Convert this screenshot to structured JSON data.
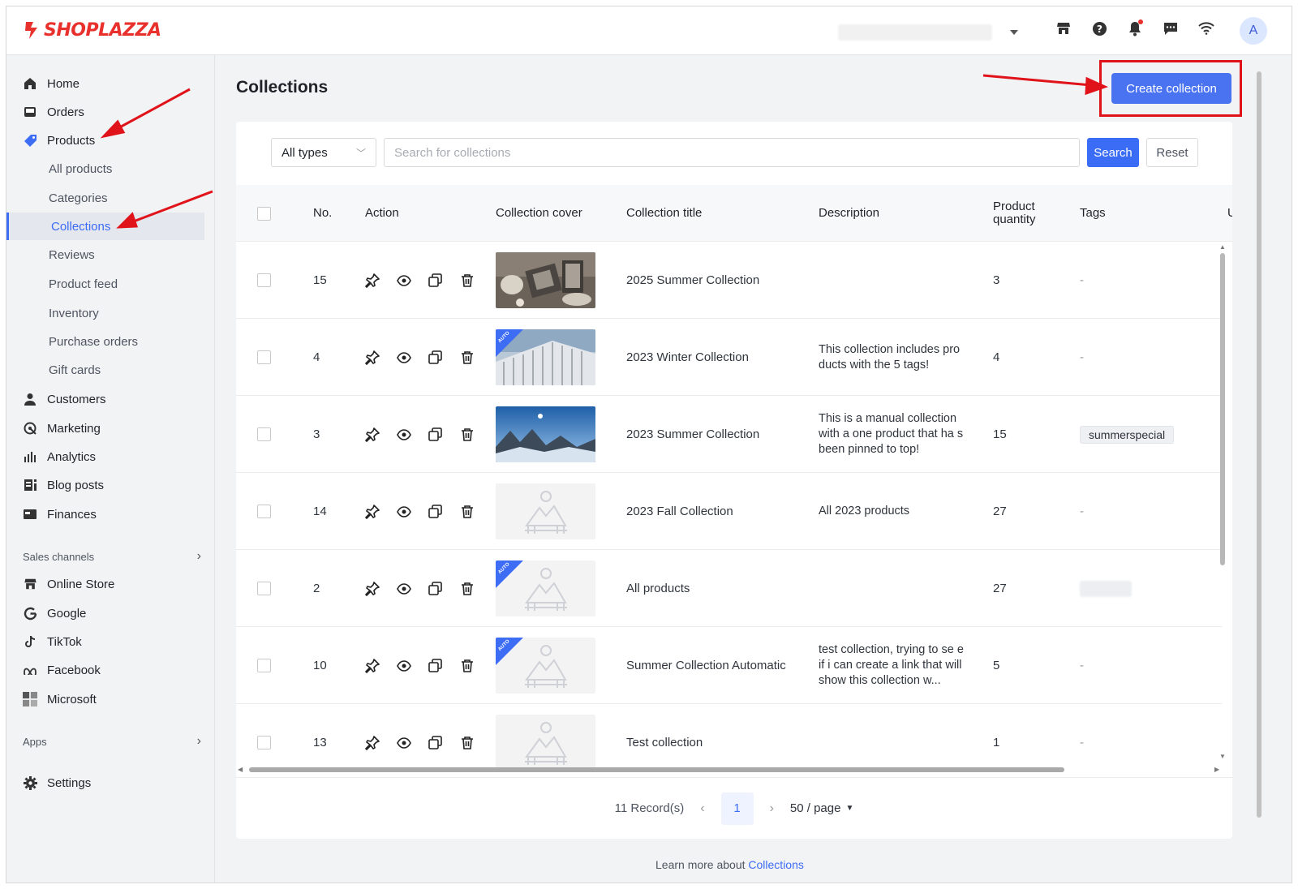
{
  "brand": {
    "name": "SHOPLAZZA",
    "color": "#e8302c"
  },
  "topbar": {
    "icons": [
      "store-icon",
      "help-icon",
      "bell-icon",
      "chat-icon",
      "wifi-icon"
    ],
    "avatar_letter": "A"
  },
  "sidebar": {
    "main_items": [
      {
        "label": "Home",
        "icon": "home-icon"
      },
      {
        "label": "Orders",
        "icon": "orders-icon"
      },
      {
        "label": "Products",
        "icon": "tag-icon"
      }
    ],
    "product_sub_items": [
      "All products",
      "Categories",
      "Collections",
      "Reviews",
      "Product feed",
      "Inventory",
      "Purchase orders",
      "Gift cards"
    ],
    "active_sub_item": "Collections",
    "more_items": [
      {
        "label": "Customers",
        "icon": "person-icon"
      },
      {
        "label": "Marketing",
        "icon": "marketing-icon"
      },
      {
        "label": "Analytics",
        "icon": "analytics-icon"
      },
      {
        "label": "Blog posts",
        "icon": "blog-icon"
      },
      {
        "label": "Finances",
        "icon": "finances-icon"
      }
    ],
    "sales_channels_label": "Sales channels",
    "channels": [
      {
        "label": "Online Store",
        "icon": "store-icon"
      },
      {
        "label": "Google",
        "icon": "google-icon"
      },
      {
        "label": "TikTok",
        "icon": "tiktok-icon"
      },
      {
        "label": "Facebook",
        "icon": "meta-icon"
      },
      {
        "label": "Microsoft",
        "icon": "microsoft-icon"
      }
    ],
    "apps_label": "Apps",
    "settings_label": "Settings"
  },
  "page": {
    "title": "Collections",
    "create_button": "Create collection"
  },
  "filters": {
    "type_select": "All types",
    "search_placeholder": "Search for collections",
    "search_button": "Search",
    "reset_button": "Reset"
  },
  "table": {
    "headers": {
      "no": "No.",
      "action": "Action",
      "cover": "Collection cover",
      "title": "Collection title",
      "description": "Description",
      "quantity_line1": "Product",
      "quantity_line2": "quantity",
      "tags": "Tags"
    },
    "rows": [
      {
        "no": "15",
        "title": "2025 Summer Collection",
        "description": "",
        "quantity": "3",
        "tag": "-",
        "cover": "photo-ceramics",
        "auto": false
      },
      {
        "no": "4",
        "title": "2023 Winter Collection",
        "description": "This collection includes pro ducts with the 5 tags!",
        "quantity": "4",
        "tag": "-",
        "cover": "photo-building",
        "auto": true
      },
      {
        "no": "3",
        "title": "2023 Summer Collection",
        "description": "This is a manual collection with a one product that ha s been pinned to top!",
        "quantity": "15",
        "tag": "summerspecial",
        "cover": "photo-mountains",
        "auto": false
      },
      {
        "no": "14",
        "title": "2023 Fall Collection",
        "description": "All 2023 products",
        "quantity": "27",
        "tag": "-",
        "cover": "placeholder",
        "auto": false
      },
      {
        "no": "2",
        "title": "All products",
        "description": "",
        "quantity": "27",
        "tag": "",
        "cover": "placeholder",
        "auto": true
      },
      {
        "no": "10",
        "title": "Summer Collection Automatic",
        "description": "test collection, trying to se e if i can create a link that will show this collection w...",
        "quantity": "5",
        "tag": "-",
        "cover": "placeholder",
        "auto": true
      },
      {
        "no": "13",
        "title": "Test collection",
        "description": "",
        "quantity": "1",
        "tag": "-",
        "cover": "placeholder",
        "auto": false
      }
    ],
    "auto_badge": "AUTO"
  },
  "pagination": {
    "records": "11 Record(s)",
    "current_page": "1",
    "per_page": "50 / page"
  },
  "footer": {
    "prefix": "Learn more about ",
    "link": "Collections"
  },
  "colors": {
    "primary": "#3d6cf5",
    "annotation_red": "#e0121a"
  }
}
